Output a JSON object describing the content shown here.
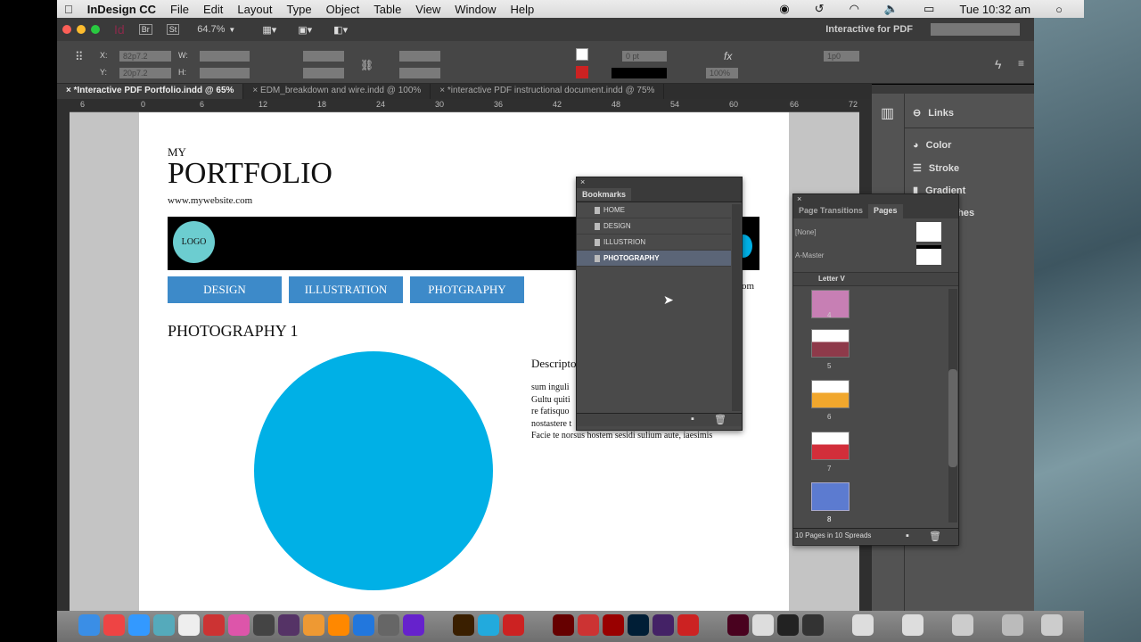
{
  "menubar": {
    "app": "InDesign CC",
    "items": [
      "File",
      "Edit",
      "Layout",
      "Type",
      "Object",
      "Table",
      "View",
      "Window",
      "Help"
    ],
    "clock": "Tue 10:32 am"
  },
  "appbar": {
    "logo": "Id",
    "bridge": "Br",
    "stock": "St",
    "zoom": "64.7%",
    "workspace": "Interactive for PDF"
  },
  "control": {
    "x_label": "X:",
    "x": "82p7.2",
    "y_label": "Y:",
    "y": "20p7.2",
    "w_label": "W:",
    "h_label": "H:",
    "stroke": "0 pt",
    "opacity": "100%",
    "offset": "1p0"
  },
  "tabs": [
    "*Interactive PDF Portfolio.indd @ 65%",
    "EDM_breakdown and wire.indd @ 100%",
    "*interactive PDF instructional document.indd @ 75%"
  ],
  "ruler": [
    "6",
    "0",
    "6",
    "12",
    "18",
    "24",
    "30",
    "36",
    "42",
    "48",
    "54",
    "60",
    "66",
    "72"
  ],
  "doc": {
    "my": "MY",
    "title": "PORTFOLIO",
    "url": "www.mywebsite.com",
    "logo": "LOGO",
    "nav": [
      "DESIGN",
      "ILLUSTRATION",
      "PHOTGRAPHY"
    ],
    "om": "om",
    "heading": "PHOTOGRAPHY 1",
    "desc": "Descripto",
    "body": [
      "sum inguli",
      "Gultu quiti",
      "re fatisquo",
      "nostastere t",
      "Facie te norsus hostem sesidi sulium aute, iaesimis"
    ],
    "circle_color": "#00b0e6",
    "button_color": "#3d8ac9",
    "logo_color": "#6ccdd0"
  },
  "bookmarks": {
    "title": "Bookmarks",
    "items": [
      "HOME",
      "DESIGN",
      "ILLUSTRION",
      "PHOTOGRAPHY"
    ],
    "selected": "PHOTOGRAPHY"
  },
  "side_panels": [
    "Links",
    "Color",
    "Stroke",
    "Gradient",
    "Swatches"
  ],
  "pages": {
    "tab1": "Page Transitions",
    "tab2": "Pages",
    "masters": [
      "[None]",
      "A-Master"
    ],
    "size": "Letter V",
    "pages": [
      "4",
      "5",
      "6",
      "7",
      "8"
    ],
    "footer": "10 Pages in 10 Spreads"
  }
}
